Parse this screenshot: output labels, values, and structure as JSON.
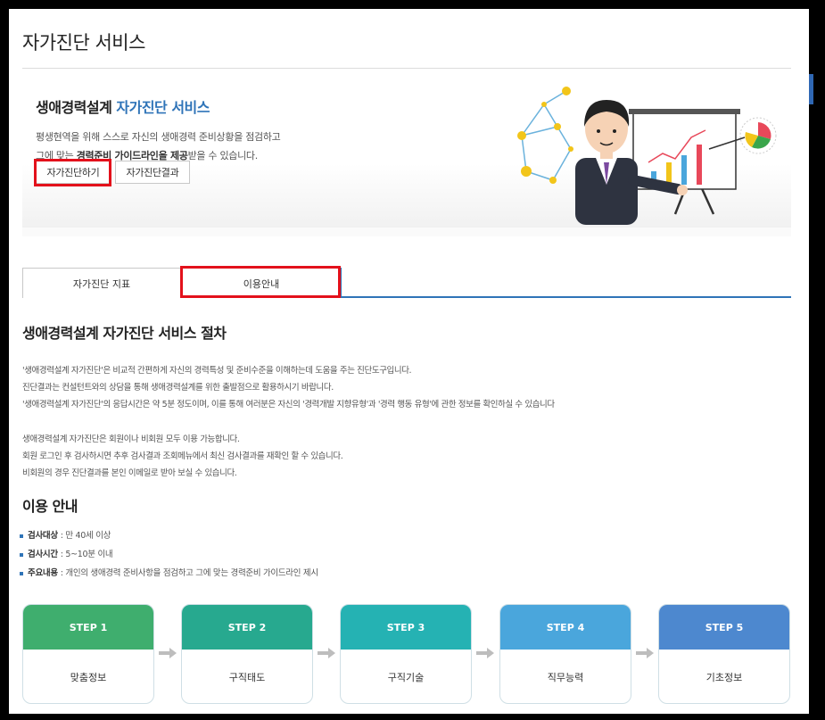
{
  "page_title": "자가진단 서비스",
  "hero": {
    "title_main": "생애경력설계 ",
    "title_accent": "자가진단 서비스",
    "desc_line1": "평생현역을 위해 스스로 자신의 생애경력 준비상황을 점검하고",
    "desc_line2_pre": "그에 맞는 ",
    "desc_line2_bold": "경력준비 가이드라인을 제공",
    "desc_line2_post": "받을 수 있습니다.",
    "btn_diagnose": "자가진단하기",
    "btn_result": "자가진단결과"
  },
  "tabs": [
    {
      "label": "자가진단 지표"
    },
    {
      "label": "이용안내"
    }
  ],
  "procedure": {
    "heading": "생애경력설계 자가진단 서비스 절차",
    "p1": "'생애경력설계 자가진단'은 비교적 간편하게 자신의 경력특성 및 준비수준을 이해하는데 도움을 주는 진단도구입니다.",
    "p2": "진단결과는 컨설턴트와의 상담을 통해 생애경력설계를 위한 출발점으로 활용하시기 바랍니다.",
    "p3": "'생애경력설계 자가진단'의 응답시간은 약 5분 정도이며, 이를 통해 여러분은 자신의 '경력개발 지향유형'과 '경력 행동 유형'에 관한 정보를 확인하실 수 있습니다",
    "p4": "생애경력설계 자가진단은 회원이나 비회원 모두 이용 가능합니다.",
    "p5": "회원 로그인 후 검사하시면 추후 검사결과 조회메뉴에서 최신 검사결과를 재확인 할 수 있습니다.",
    "p6": "비회원의 경우 진단결과를 본인 이메일로 받아 보실 수 있습니다."
  },
  "guide": {
    "heading": "이용 안내",
    "items": [
      {
        "label": "검사대상",
        "value": " : 만 40세 이상"
      },
      {
        "label": "검사시간",
        "value": " : 5~10분 이내"
      },
      {
        "label": "주요내용",
        "value": " : 개인의 생애경력 준비사항을 점검하고 그에 맞는 경력준비 가이드라인 제시"
      }
    ]
  },
  "steps": [
    {
      "step": "STEP 1",
      "name": "맞춤정보",
      "color": "#3fae6e"
    },
    {
      "step": "STEP 2",
      "name": "구직태도",
      "color": "#27a98f"
    },
    {
      "step": "STEP 3",
      "name": "구직기술",
      "color": "#25b2b3"
    },
    {
      "step": "STEP 4",
      "name": "직무능력",
      "color": "#4aa6dc"
    },
    {
      "step": "STEP 5",
      "name": "기초정보",
      "color": "#4d88cf"
    }
  ],
  "colors": {
    "accent": "#2f74b8",
    "highlight_box": "#e3111b"
  },
  "icons": [
    "consultant-illustration",
    "network-nodes-icon",
    "pie-chart-icon",
    "arrow-right-icon"
  ]
}
